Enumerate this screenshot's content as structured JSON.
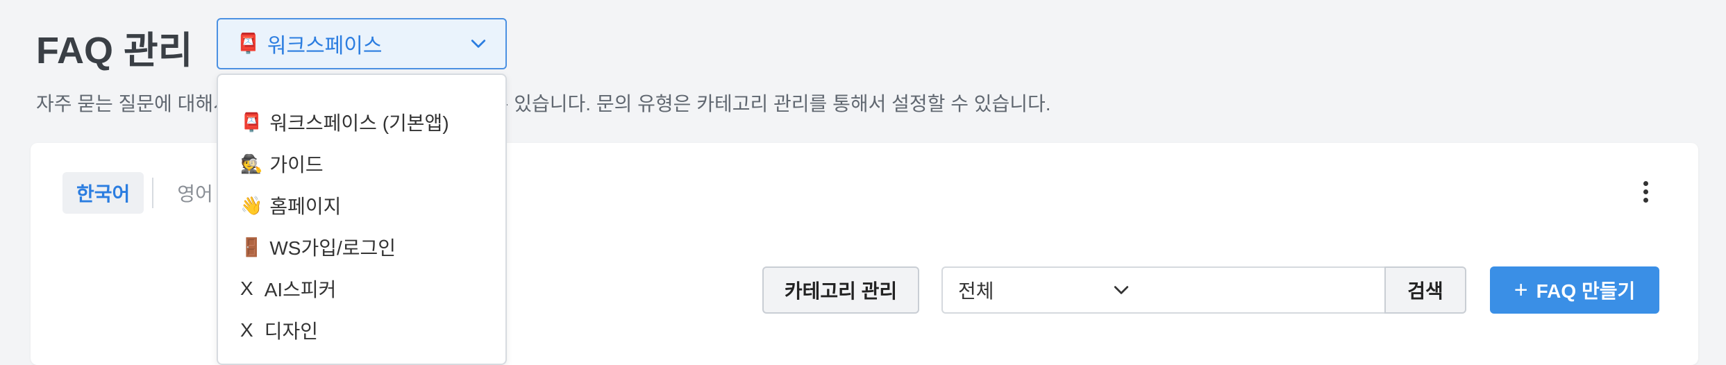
{
  "header": {
    "title": "FAQ 관리",
    "workspace_select": {
      "icon": "📮",
      "label": "워크스페이스"
    },
    "description": "자주 묻는 질문에 대해서 질문과 답변을 등록하고 관리할 수 있습니다. 문의 유형은 카테고리 관리를 통해서 설정할 수 있습니다."
  },
  "workspace_dropdown": {
    "items": [
      {
        "icon": "📮",
        "label": "워크스페이스 (기본앱)"
      },
      {
        "icon": "🕵",
        "label": "가이드"
      },
      {
        "icon": "👋",
        "label": "홈페이지"
      },
      {
        "icon": "🚪",
        "label": "WS가입/로그인"
      },
      {
        "icon": "X",
        "label": "AI스피커"
      },
      {
        "icon": "X",
        "label": "디자인"
      }
    ]
  },
  "language_tabs": [
    {
      "label": "한국어",
      "active": true
    },
    {
      "label": "영어",
      "active": false
    }
  ],
  "toolbar": {
    "category_button": "카테고리 관리",
    "type_filter": "전체",
    "search_value": "",
    "search_button": "검색",
    "create_button": "FAQ 만들기",
    "create_icon": "+"
  },
  "colors": {
    "accent": "#2b7de0",
    "primary_button": "#3a8fe6",
    "select_background": "#eaf3fc",
    "page_background": "#f3f4f6"
  }
}
